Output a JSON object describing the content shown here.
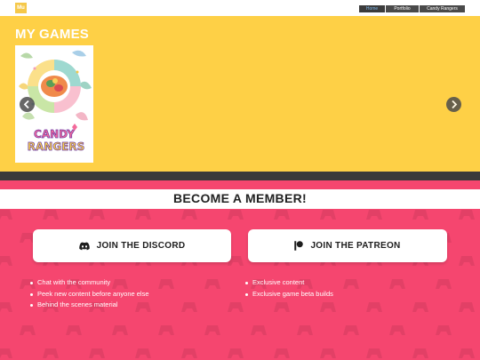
{
  "header": {
    "logo_text": "Mu",
    "nav": [
      {
        "label": "Home"
      },
      {
        "label": "Portfolio"
      },
      {
        "label": "Candy Rangers"
      }
    ]
  },
  "games": {
    "title": "MY GAMES",
    "cards": [
      {
        "title_line1": "CANDY",
        "title_line2": "RANGERS"
      }
    ],
    "prev_icon": "chevron-left-icon",
    "next_icon": "chevron-right-icon"
  },
  "membership": {
    "title": "BECOME A MEMBER!",
    "discord": {
      "label": "JOIN THE DISCORD",
      "icon": "discord-icon",
      "perks": [
        "Chat with the community",
        "Peek new content before anyone else",
        "Behind the scenes material"
      ]
    },
    "patreon": {
      "label": "JOIN THE PATREON",
      "icon": "patreon-icon",
      "perks": [
        "Exclusive content",
        "Exclusive game beta builds"
      ]
    }
  },
  "colors": {
    "games_bg": "#fed046",
    "member_bg": "#f5466f",
    "dark_band": "#3a3a3a",
    "nav_active_text": "#7fb7e8"
  }
}
